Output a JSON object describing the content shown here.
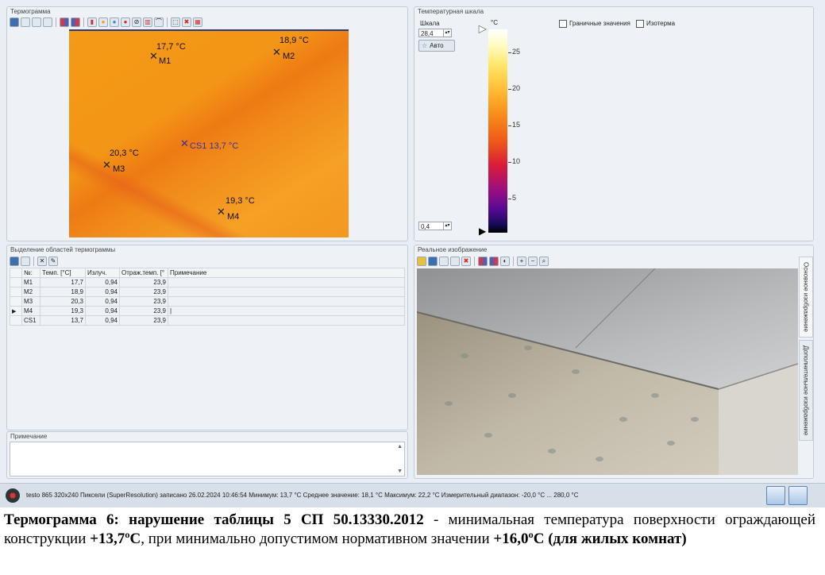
{
  "thermogram": {
    "title": "Термограмма",
    "markers": [
      {
        "id": "M1",
        "label": "17,7 °C"
      },
      {
        "id": "M2",
        "label": "18,9 °C"
      },
      {
        "id": "M3",
        "label": "20,3 °C"
      },
      {
        "id": "M4",
        "label": "19,3 °C"
      },
      {
        "id": "CS1",
        "label": "CS1 13,7 °C"
      }
    ]
  },
  "scale_panel": {
    "title": "Температурная шкала",
    "scale_label": "Шкала",
    "max_value": "28,4",
    "min_value": "0,4",
    "auto_label": "Авто",
    "unit": "°C",
    "ticks": [
      "25",
      "20",
      "15",
      "10",
      "5"
    ],
    "limits_label": "Граничные значения",
    "isotherm_label": "Изотерма"
  },
  "regions": {
    "title": "Выделение областей термограммы",
    "columns": [
      "№:",
      "Темп. [°C]",
      "Излуч.",
      "Отраж.темп. [°",
      "Примечание"
    ],
    "rows": [
      {
        "id": "M1",
        "temp": "17,7",
        "emis": "0,94",
        "refl": "23,9"
      },
      {
        "id": "M2",
        "temp": "18,9",
        "emis": "0,94",
        "refl": "23,9"
      },
      {
        "id": "M3",
        "temp": "20,3",
        "emis": "0,94",
        "refl": "23,9"
      },
      {
        "id": "M4",
        "temp": "19,3",
        "emis": "0,94",
        "refl": "23,9"
      },
      {
        "id": "CS1",
        "temp": "13,7",
        "emis": "0,94",
        "refl": "23,9"
      }
    ]
  },
  "note": {
    "title": "Примечание"
  },
  "real_image": {
    "title": "Реальное изображение",
    "tab_main": "Основное изображение",
    "tab_extra": "Дополнительное изображение"
  },
  "status_bar": {
    "text": "testo 865 320x240 Пиксели (SuperResolution) записано 26.02.2024 10:46:54 Минимум: 13,7 °C Среднее значение: 18,1 °C Максимум: 22,2 °C Измерительный диапазон: -20,0 °C ... 280,0 °C"
  },
  "caption": {
    "bold_part": "Термограмма 6: нарушение таблицы 5 СП 50.13330.2012",
    "text1": " - минимальная температура поверхности ограждающей конструкции ",
    "value1": "+13,7ºС",
    "text2": ", при минимально допустимом нормативном значении ",
    "value2": "+16,0ºС (для жилых комнат)"
  }
}
